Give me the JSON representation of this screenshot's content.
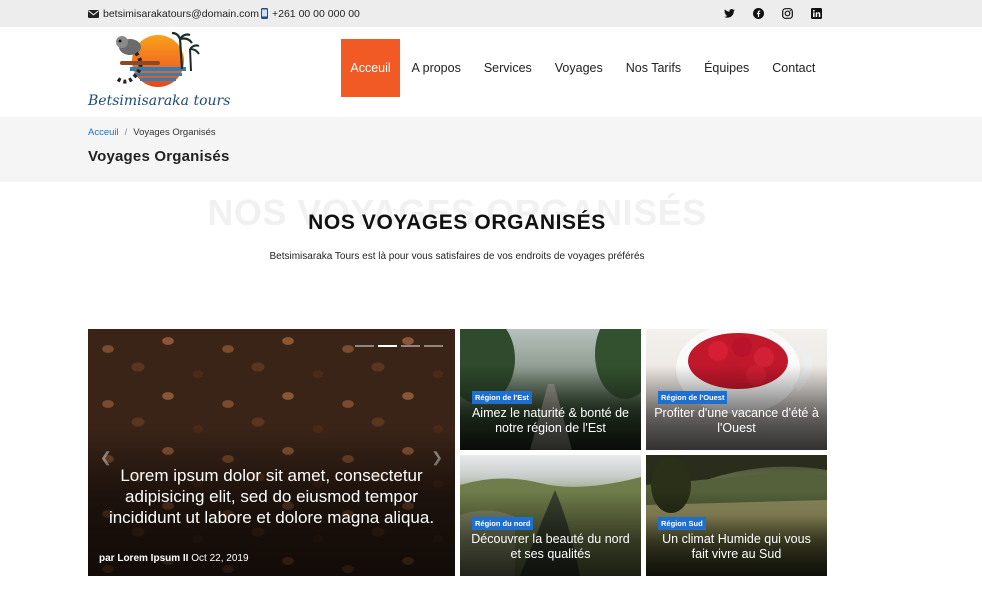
{
  "topbar": {
    "email": "betsimisarakatours@domain.com",
    "phone": "+261 00 00 000 00",
    "social": [
      "twitter-icon",
      "facebook-icon",
      "instagram-icon",
      "linkedin-icon"
    ]
  },
  "logo": {
    "text": "Betsimisaraka tours"
  },
  "nav": [
    {
      "label": "Acceuil",
      "active": true
    },
    {
      "label": "A propos"
    },
    {
      "label": "Services"
    },
    {
      "label": "Voyages"
    },
    {
      "label": "Nos Tarifs"
    },
    {
      "label": "Équipes"
    },
    {
      "label": "Contact"
    }
  ],
  "breadcrumb": {
    "home": "Acceuil",
    "separator": "/",
    "current": "Voyages Organisés"
  },
  "page_title": "Voyages Organisés",
  "section": {
    "ghost": "NOS VOYAGES ORGANISÉS",
    "title": "NOS VOYAGES ORGANISÉS",
    "subtitle": "Betsimisaraka Tours est là pour vous satisfaires de vos endroits de voyages préférés"
  },
  "featured": {
    "title": "Lorem ipsum dolor sit amet, consectetur adipisicing elit, sed do eiusmod tempor incididunt ut labore et dolore magna aliqua.",
    "author": "par Lorem Ipsum II",
    "date": "Oct 22, 2019",
    "slide_count": 4,
    "active_slide": 2
  },
  "cards": [
    {
      "badge": "Région de l'Est",
      "title": "Aimez le naturité & bonté de notre région de l'Est"
    },
    {
      "badge": "Région de l'Ouest",
      "title": "Profiter d'une vacance d'été à l'Ouest"
    },
    {
      "badge": "Région du nord",
      "title": "Découvrer la beauté du nord et ses qualités"
    },
    {
      "badge": "Région Sud",
      "title": "Un climat Humide qui vous fait vivre au Sud"
    }
  ],
  "colors": {
    "accent": "#f15a24",
    "link": "#1a73c8",
    "badge": "#1f6fd1"
  }
}
